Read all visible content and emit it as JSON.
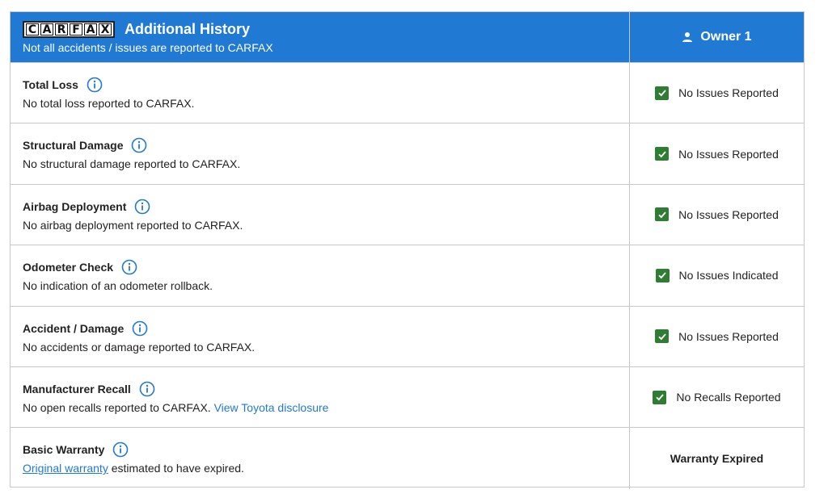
{
  "header": {
    "logo_letters": [
      "C",
      "A",
      "R",
      "F",
      "A",
      "X"
    ],
    "title": "Additional History",
    "subtitle": "Not all accidents / issues are reported to CARFAX",
    "owner_label": "Owner 1"
  },
  "rows": [
    {
      "title": "Total Loss",
      "desc": "No total loss reported to CARFAX.",
      "status": "No Issues Reported"
    },
    {
      "title": "Structural Damage",
      "desc": "No structural damage reported to CARFAX.",
      "status": "No Issues Reported"
    },
    {
      "title": "Airbag Deployment",
      "desc": "No airbag deployment reported to CARFAX.",
      "status": "No Issues Reported"
    },
    {
      "title": "Odometer Check",
      "desc": "No indication of an odometer rollback.",
      "status": "No Issues Indicated"
    },
    {
      "title": "Accident / Damage",
      "desc": "No accidents or damage reported to CARFAX.",
      "status": "No Issues Reported"
    },
    {
      "title": "Manufacturer Recall",
      "desc": "No open recalls reported to CARFAX.",
      "link": "View Toyota disclosure",
      "status": "No Recalls Reported"
    },
    {
      "title": "Basic Warranty",
      "link": "Original warranty",
      "desc": "estimated to have expired.",
      "status": "Warranty Expired"
    }
  ],
  "colors": {
    "header_bg": "#2079d3",
    "check_green": "#2e7d32",
    "link_blue": "#2079d3"
  },
  "icons": {
    "info": "info-circle-icon",
    "owner": "person-icon",
    "status": "checkmark-icon"
  }
}
